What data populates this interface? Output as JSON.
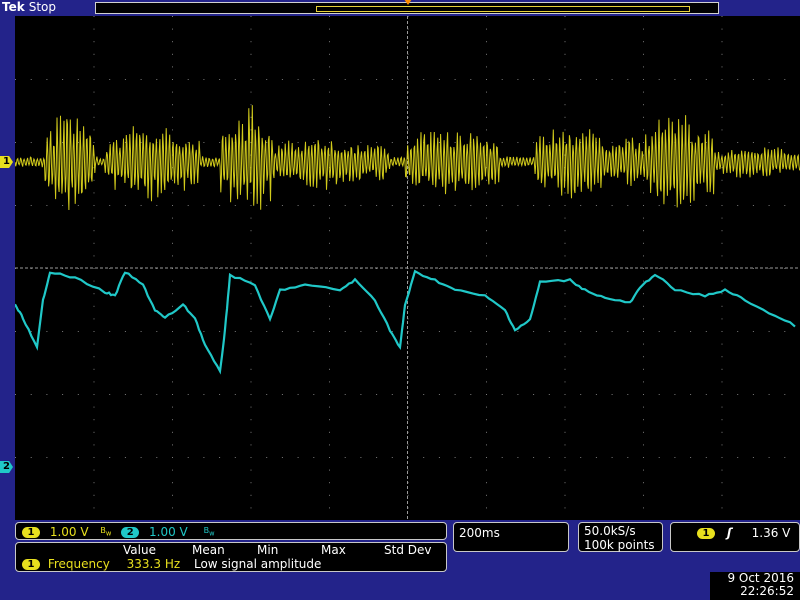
{
  "header": {
    "brand": "Tek",
    "status": "Stop"
  },
  "channels": [
    {
      "id": "1",
      "volts_div": "1.00 V",
      "bw_icon": "bandwidth-limit-icon",
      "color": "#e8e01e"
    },
    {
      "id": "2",
      "volts_div": "1.00 V",
      "bw_icon": "bandwidth-limit-icon",
      "color": "#20c8c8"
    }
  ],
  "timebase": {
    "time_div": "200ms"
  },
  "acquisition": {
    "sample_rate": "50.0kS/s",
    "record_length": "100k points"
  },
  "trigger": {
    "source": "1",
    "slope_icon": "rising-edge-icon",
    "level": "1.36 V",
    "level_color": "#ff8c00"
  },
  "measurements": {
    "headers": [
      "Value",
      "Mean",
      "Min",
      "Max",
      "Std Dev"
    ],
    "rows": [
      {
        "source": "1",
        "name": "Frequency",
        "value": "333.3 Hz",
        "note": "Low signal amplitude"
      }
    ]
  },
  "datetime": {
    "date": "9 Oct  2016",
    "time": "22:26:52"
  },
  "colors": {
    "background": "#23238a",
    "graticule_bg": "#000000",
    "grid": "#7a7a7a"
  }
}
